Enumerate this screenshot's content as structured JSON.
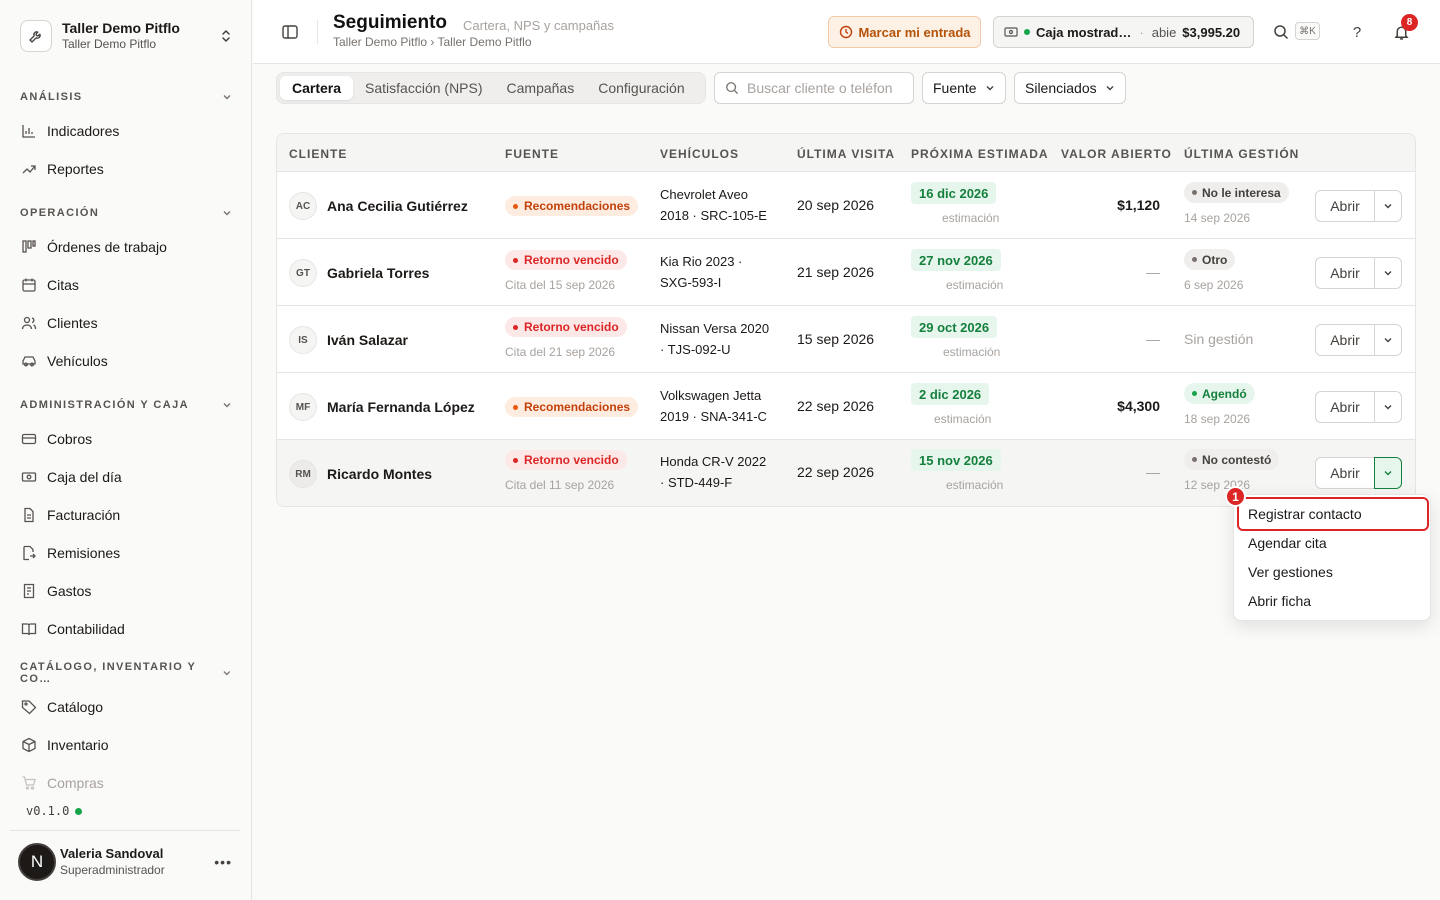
{
  "org": {
    "name": "Taller Demo Pitflo",
    "subtitle": "Taller Demo Pitflo"
  },
  "sidebar": {
    "sections": [
      {
        "title": "ANÁLISIS"
      },
      {
        "title": "OPERACIÓN"
      },
      {
        "title": "ADMINISTRACIÓN Y CAJA"
      },
      {
        "title": "CATÁLOGO, INVENTARIO Y CO…"
      }
    ],
    "items": [
      {
        "label": "Indicadores",
        "icon": "bar-chart-icon"
      },
      {
        "label": "Reportes",
        "icon": "trend-icon"
      },
      {
        "label": "Órdenes de trabajo",
        "icon": "kanban-icon"
      },
      {
        "label": "Citas",
        "icon": "calendar-icon"
      },
      {
        "label": "Clientes",
        "icon": "users-icon"
      },
      {
        "label": "Vehículos",
        "icon": "car-icon"
      },
      {
        "label": "Cobros",
        "icon": "card-icon"
      },
      {
        "label": "Caja del día",
        "icon": "cash-icon"
      },
      {
        "label": "Facturación",
        "icon": "file-icon"
      },
      {
        "label": "Remisiones",
        "icon": "file-arrow-icon"
      },
      {
        "label": "Gastos",
        "icon": "receipt-icon"
      },
      {
        "label": "Contabilidad",
        "icon": "book-icon"
      },
      {
        "label": "Catálogo",
        "icon": "tag-icon"
      },
      {
        "label": "Inventario",
        "icon": "box-icon"
      },
      {
        "label": "Compras",
        "icon": "cart-icon"
      }
    ],
    "version": "v0.1.0"
  },
  "user": {
    "initial": "N",
    "name": "Valeria Sandoval",
    "role": "Superadministrador"
  },
  "header": {
    "title": "Seguimiento",
    "subtitle": "Cartera, NPS y campañas",
    "breadcrumb": "Taller Demo Pitflo › Taller Demo Pitflo",
    "entry_button": "Marcar mi entrada",
    "caja": {
      "name": "Caja mostrad…",
      "separator": "·",
      "state": "abie",
      "amount": "$3,995.20"
    },
    "shortcut": "⌘K",
    "help": "?",
    "notifications": "8"
  },
  "toolbar": {
    "tabs": [
      "Cartera",
      "Satisfacción (NPS)",
      "Campañas",
      "Configuración"
    ],
    "active_tab": "Cartera",
    "search_placeholder": "Buscar cliente o teléfon",
    "filter_source": "Fuente",
    "filter_muted": "Silenciados"
  },
  "table": {
    "headers": [
      "CLIENTE",
      "FUENTE",
      "VEHÍCULOS",
      "ÚLTIMA VISITA",
      "PRÓXIMA ESTIMADA",
      "VALOR ABIERTO",
      "ÚLTIMA GESTIÓN"
    ],
    "open_label": "Abrir",
    "rows": [
      {
        "initials": "AC",
        "name": "Ana Cecilia Gutiérrez",
        "source": "Recomendaciones",
        "source_note": "",
        "vehicle_1": "Chevrolet Aveo",
        "vehicle_2": "2018 · SRC-105-E",
        "last_visit": "20 sep 2026",
        "next": "16 dic 2026",
        "next_note": "estimación",
        "open_value": "$1,120",
        "gestion": "No le interesa",
        "gestion_date": "14 sep 2026"
      },
      {
        "initials": "GT",
        "name": "Gabriela Torres",
        "source": "Retorno vencido",
        "source_note": "Cita del 15 sep 2026",
        "vehicle_1": "Kia Rio 2023 ·",
        "vehicle_2": "SXG-593-I",
        "last_visit": "21 sep 2026",
        "next": "27 nov 2026",
        "next_note": "estimación",
        "open_value": "—",
        "gestion": "Otro",
        "gestion_date": "6 sep 2026"
      },
      {
        "initials": "IS",
        "name": "Iván Salazar",
        "source": "Retorno vencido",
        "source_note": "Cita del 21 sep 2026",
        "vehicle_1": "Nissan Versa 2020",
        "vehicle_2": "· TJS-092-U",
        "last_visit": "15 sep 2026",
        "next": "29 oct 2026",
        "next_note": "estimación",
        "open_value": "—",
        "gestion": "Sin gestión",
        "gestion_date": ""
      },
      {
        "initials": "MF",
        "name": "María Fernanda López",
        "source": "Recomendaciones",
        "source_note": "",
        "vehicle_1": "Volkswagen Jetta",
        "vehicle_2": "2019 · SNA-341-C",
        "last_visit": "22 sep 2026",
        "next": "2 dic 2026",
        "next_note": "estimación",
        "open_value": "$4,300",
        "gestion": "Agendó",
        "gestion_date": "18 sep 2026"
      },
      {
        "initials": "RM",
        "name": "Ricardo Montes",
        "source": "Retorno vencido",
        "source_note": "Cita del 11 sep 2026",
        "vehicle_1": "Honda CR-V 2022",
        "vehicle_2": "· STD-449-F",
        "last_visit": "22 sep 2026",
        "next": "15 nov 2026",
        "next_note": "estimación",
        "open_value": "—",
        "gestion": "No contestó",
        "gestion_date": "12 sep 2026"
      }
    ]
  },
  "menu": {
    "items": [
      "Registrar contacto",
      "Agendar cita",
      "Ver gestiones",
      "Abrir ficha"
    ],
    "step": "1"
  }
}
